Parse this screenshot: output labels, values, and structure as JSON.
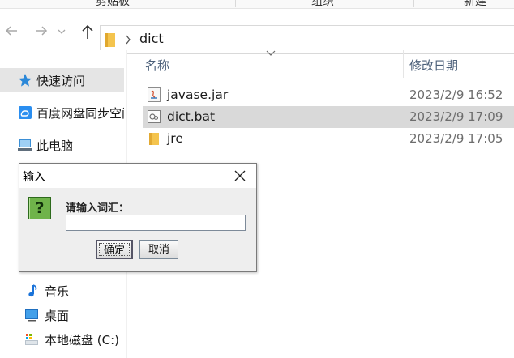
{
  "ribbon": {
    "groups": [
      "剪贴板",
      "组织",
      "新建"
    ]
  },
  "address": {
    "back_icon": "arrow-left-icon",
    "forward_icon": "arrow-right-icon",
    "up_icon": "arrow-up-icon",
    "path": "dict"
  },
  "columns": {
    "name": "名称",
    "date_modified": "修改日期"
  },
  "nav": {
    "items": [
      {
        "label": "快速访问",
        "icon": "star-icon"
      },
      {
        "label": "百度网盘同步空间",
        "icon": "cloud-sync-icon"
      },
      {
        "label": "此电脑",
        "icon": "computer-icon"
      },
      {
        "label": "音乐",
        "icon": "music-icon"
      },
      {
        "label": "桌面",
        "icon": "desktop-icon"
      },
      {
        "label": "本地磁盘 (C:)",
        "icon": "drive-icon"
      }
    ]
  },
  "files": [
    {
      "name": "javase.jar",
      "date": "2023/2/9 16:52",
      "icon": "jar-file-icon"
    },
    {
      "name": "dict.bat",
      "date": "2023/2/9 17:09",
      "icon": "batch-file-icon"
    },
    {
      "name": "jre",
      "date": "2023/2/9 17:05",
      "icon": "folder-icon"
    }
  ],
  "dialog": {
    "title": "输入",
    "prompt": "请输入词汇：",
    "input_value": "",
    "ok_label": "确定",
    "cancel_label": "取消",
    "question_mark": "?"
  },
  "colors": {
    "selected_row": "#d9d9d9",
    "nav_selected": "#e5e5e5",
    "question_icon": "#6fb34a"
  }
}
